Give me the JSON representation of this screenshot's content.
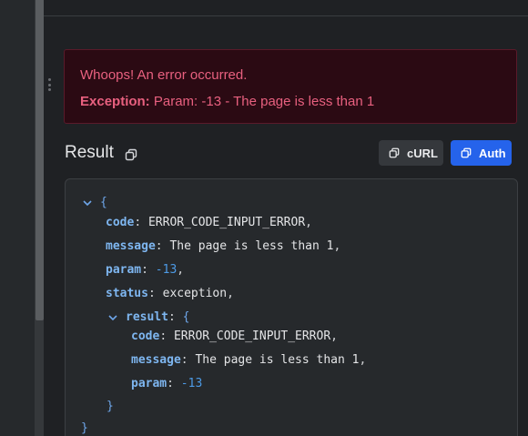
{
  "error": {
    "title": "Whoops! An error occurred.",
    "exception_label": "Exception:",
    "exception_message": "Param: -13 - The page is less than 1"
  },
  "result": {
    "heading": "Result",
    "curl_label": "cURL",
    "auth_label": "Auth"
  },
  "json_view": {
    "open_brace": "{",
    "close_brace": "}",
    "code_key": "code",
    "code_value": "ERROR_CODE_INPUT_ERROR",
    "message_key": "message",
    "message_value": "The page is less than 1",
    "param_key": "param",
    "param_value": "-13",
    "status_key": "status",
    "status_value": "exception",
    "result_key": "result",
    "nested": {
      "code_key": "code",
      "code_value": "ERROR_CODE_INPUT_ERROR",
      "message_key": "message",
      "message_value": "The page is less than 1",
      "param_key": "param",
      "param_value": "-13"
    }
  },
  "icons": {
    "copy": "copy-icon",
    "chevron": "chevron-down-icon",
    "grip": "grip-vertical-icon"
  },
  "colors": {
    "error_text": "#e8607f",
    "error_bg": "#2b0a13",
    "auth_button": "#2563eb",
    "json_key": "#7eb6f0",
    "json_number": "#4d9be6"
  }
}
